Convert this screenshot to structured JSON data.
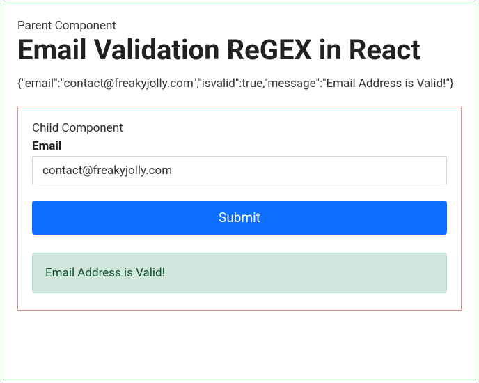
{
  "parent": {
    "label": "Parent Component",
    "heading": "Email Validation ReGEX in React",
    "json_output": "{\"email\":\"contact@freakyjolly.com\",\"isvalid\":true,\"message\":\"Email Address is Valid!\"}"
  },
  "child": {
    "label": "Child Component",
    "field_label": "Email",
    "email_value": "contact@freakyjolly.com",
    "submit_label": "Submit",
    "alert_message": "Email Address is Valid!"
  }
}
